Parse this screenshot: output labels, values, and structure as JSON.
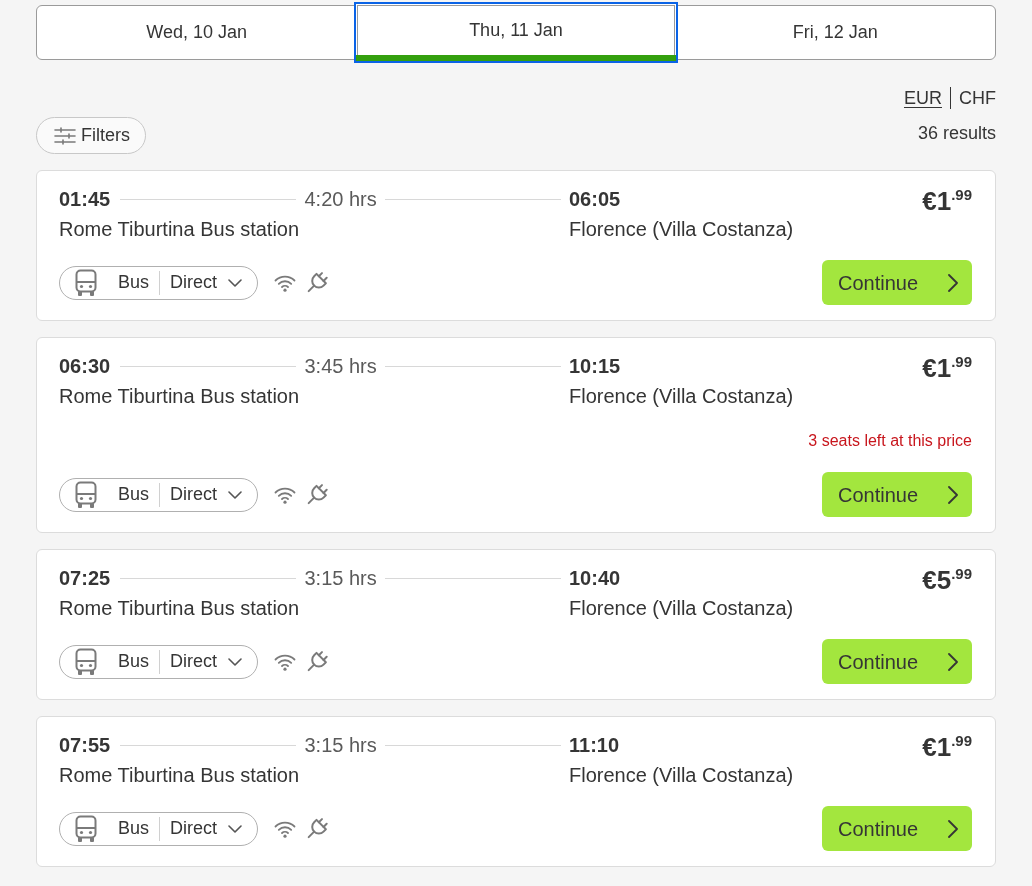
{
  "date_tabs": [
    {
      "label": "Wed, 10 Jan",
      "selected": false,
      "focused": false
    },
    {
      "label": "Thu, 11 Jan",
      "selected": true,
      "focused": true
    },
    {
      "label": "Fri, 12 Jan",
      "selected": false,
      "focused": false
    }
  ],
  "currencies": [
    {
      "label": "EUR",
      "selected": true
    },
    {
      "label": "CHF",
      "selected": false
    }
  ],
  "filters_button": {
    "label": "Filters"
  },
  "results_count": "36 results",
  "trips": [
    {
      "departure_time": "01:45",
      "duration": "4:20 hrs",
      "arrival_time": "06:05",
      "origin": "Rome Tiburtina Bus station",
      "destination": "Florence (Villa Costanza)",
      "price": "€1$^{.99}$",
      "transport": "Bus",
      "connection": "Direct",
      "amenities": [
        {
          "kind": "wifi"
        },
        {
          "kind": "power"
        }
      ],
      "button": "Continue"
    },
    {
      "departure_time": "06:30",
      "duration": "3:45 hrs",
      "arrival_time": "10:15",
      "origin": "Rome Tiburtina Bus station",
      "destination": "Florence (Villa Costanza)",
      "price": "€1$^{.99}$",
      "seats_notice": "3 seats left at this price",
      "transport": "Bus",
      "connection": "Direct",
      "amenities": [
        {
          "kind": "wifi"
        },
        {
          "kind": "power"
        }
      ],
      "button": "Continue"
    },
    {
      "departure_time": "07:25",
      "duration": "3:15 hrs",
      "arrival_time": "10:40",
      "origin": "Rome Tiburtina Bus station",
      "destination": "Florence (Villa Costanza)",
      "price": "€5$^{.99}$",
      "transport": "Bus",
      "connection": "Direct",
      "amenities": [
        {
          "kind": "wifi"
        },
        {
          "kind": "power"
        }
      ],
      "button": "Continue"
    },
    {
      "departure_time": "07:55",
      "duration": "3:15 hrs",
      "arrival_time": "11:10",
      "origin": "Rome Tiburtina Bus station",
      "destination": "Florence (Villa Costanza)",
      "price": "€1$^{.99}$",
      "transport": "Bus",
      "connection": "Direct",
      "amenities": [
        {
          "kind": "wifi"
        },
        {
          "kind": "power"
        }
      ],
      "button": "Continue"
    }
  ]
}
